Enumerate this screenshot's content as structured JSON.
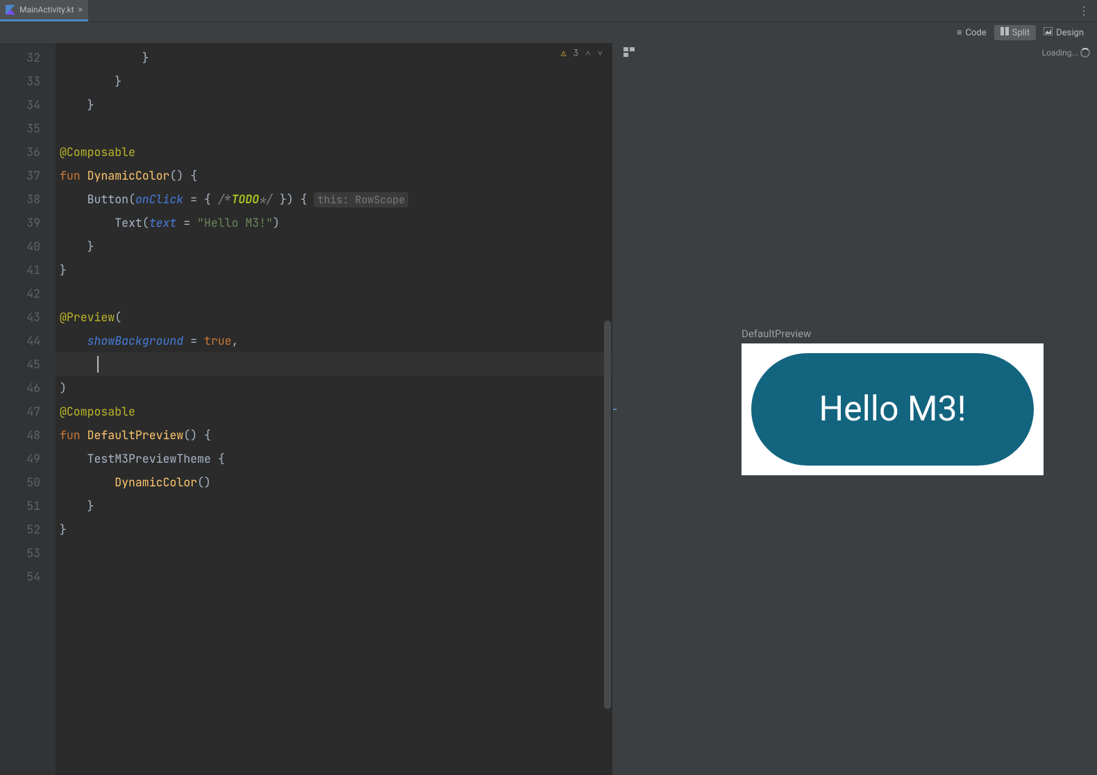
{
  "tab": {
    "filename": "MainActivity.kt"
  },
  "modes": {
    "code": "Code",
    "split": "Split",
    "design": "Design"
  },
  "inspection": {
    "warn_count": "3"
  },
  "preview": {
    "loading": "Loading...",
    "label": "DefaultPreview",
    "button_text": "Hello M3!"
  },
  "code": {
    "l32": "            }",
    "l33": "        }",
    "l34": "    }",
    "l36_ann": "@Composable",
    "l37_kw": "fun ",
    "l37_fn": "DynamicColor",
    "l37_rest": "() {",
    "l38_a": "    Button(",
    "l38_named": "onClick",
    "l38_b": " = { ",
    "l38_cmt1": "/*",
    "l38_todo": "TODO",
    "l38_cmt2": "*/",
    "l38_c": " }) { ",
    "l38_hint": "this: RowScope",
    "l39_a": "        Text(",
    "l39_named": "text",
    "l39_b": " = ",
    "l39_str": "\"Hello M3!\"",
    "l39_c": ")",
    "l40": "    }",
    "l41": "}",
    "l43_ann": "@Preview",
    "l43_rest": "(",
    "l44_a": "    ",
    "l44_named": "showBackground",
    "l44_b": " = ",
    "l44_lit": "true",
    "l44_c": ",",
    "l46": ")",
    "l47_ann": "@Composable",
    "l48_kw": "fun ",
    "l48_fn": "DefaultPreview",
    "l48_rest": "() {",
    "l49_a": "    TestM3PreviewTheme ",
    "l49_b": "{",
    "l50_a": "        ",
    "l50_fn": "DynamicColor",
    "l50_b": "()",
    "l51": "    }",
    "l52": "}"
  },
  "line_numbers": [
    "32",
    "33",
    "34",
    "35",
    "36",
    "37",
    "38",
    "39",
    "40",
    "41",
    "42",
    "43",
    "44",
    "45",
    "46",
    "47",
    "48",
    "49",
    "50",
    "51",
    "52",
    "53",
    "54"
  ]
}
